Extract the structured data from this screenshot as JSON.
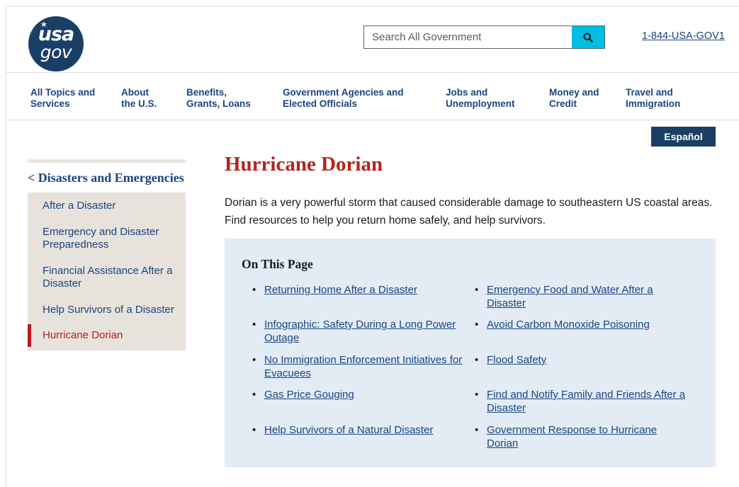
{
  "header": {
    "logo_line1": "usa",
    "logo_line2": "gov",
    "search_placeholder": "Search All Government",
    "phone": "1-844-USA-GOV1"
  },
  "nav": {
    "items": [
      {
        "label": "All Topics and Services"
      },
      {
        "label": "About the U.S."
      },
      {
        "label": "Benefits, Grants, Loans"
      },
      {
        "label": "Government Agencies and Elected Officials"
      },
      {
        "label": "Jobs and Unemployment"
      },
      {
        "label": "Money and Credit"
      },
      {
        "label": "Travel and Immigration"
      }
    ]
  },
  "language_button": "Español",
  "sidebar": {
    "parent": "< Disasters and Emergencies",
    "items": [
      {
        "label": "After a Disaster"
      },
      {
        "label": "Emergency and Disaster Preparedness"
      },
      {
        "label": "Financial Assistance After a Disaster"
      },
      {
        "label": "Help Survivors of a Disaster"
      },
      {
        "label": "Hurricane Dorian",
        "active": true
      }
    ]
  },
  "main": {
    "title": "Hurricane Dorian",
    "intro": "Dorian is a very powerful storm that caused considerable damage to southeastern US coastal areas. Find resources to help you return home safely, and help survivors.",
    "on_this_page": {
      "heading": "On This Page",
      "links": [
        {
          "label": "Returning Home After a Disaster"
        },
        {
          "label": "Emergency Food and Water After a Disaster"
        },
        {
          "label": "Infographic: Safety During a Long Power Outage"
        },
        {
          "label": "Avoid Carbon Monoxide Poisoning"
        },
        {
          "label": "No Immigration Enforcement Initiatives for Evacuees"
        },
        {
          "label": "Flood Safety"
        },
        {
          "label": "Gas Price Gouging"
        },
        {
          "label": "Find and Notify Family and Friends After a Disaster"
        },
        {
          "label": "Help Survivors of a Natural Disaster"
        },
        {
          "label": "Government Response to Hurricane Dorian"
        }
      ]
    }
  },
  "colors": {
    "brand_navy": "#1a3f66",
    "link_blue": "#1a4480",
    "title_red": "#b3261e",
    "search_button": "#00bde3",
    "panel_bg": "#e3ecf5",
    "sidebar_bg": "#e7e3dc"
  },
  "icons": {
    "search": "search-icon",
    "logo_star": "star-icon"
  }
}
